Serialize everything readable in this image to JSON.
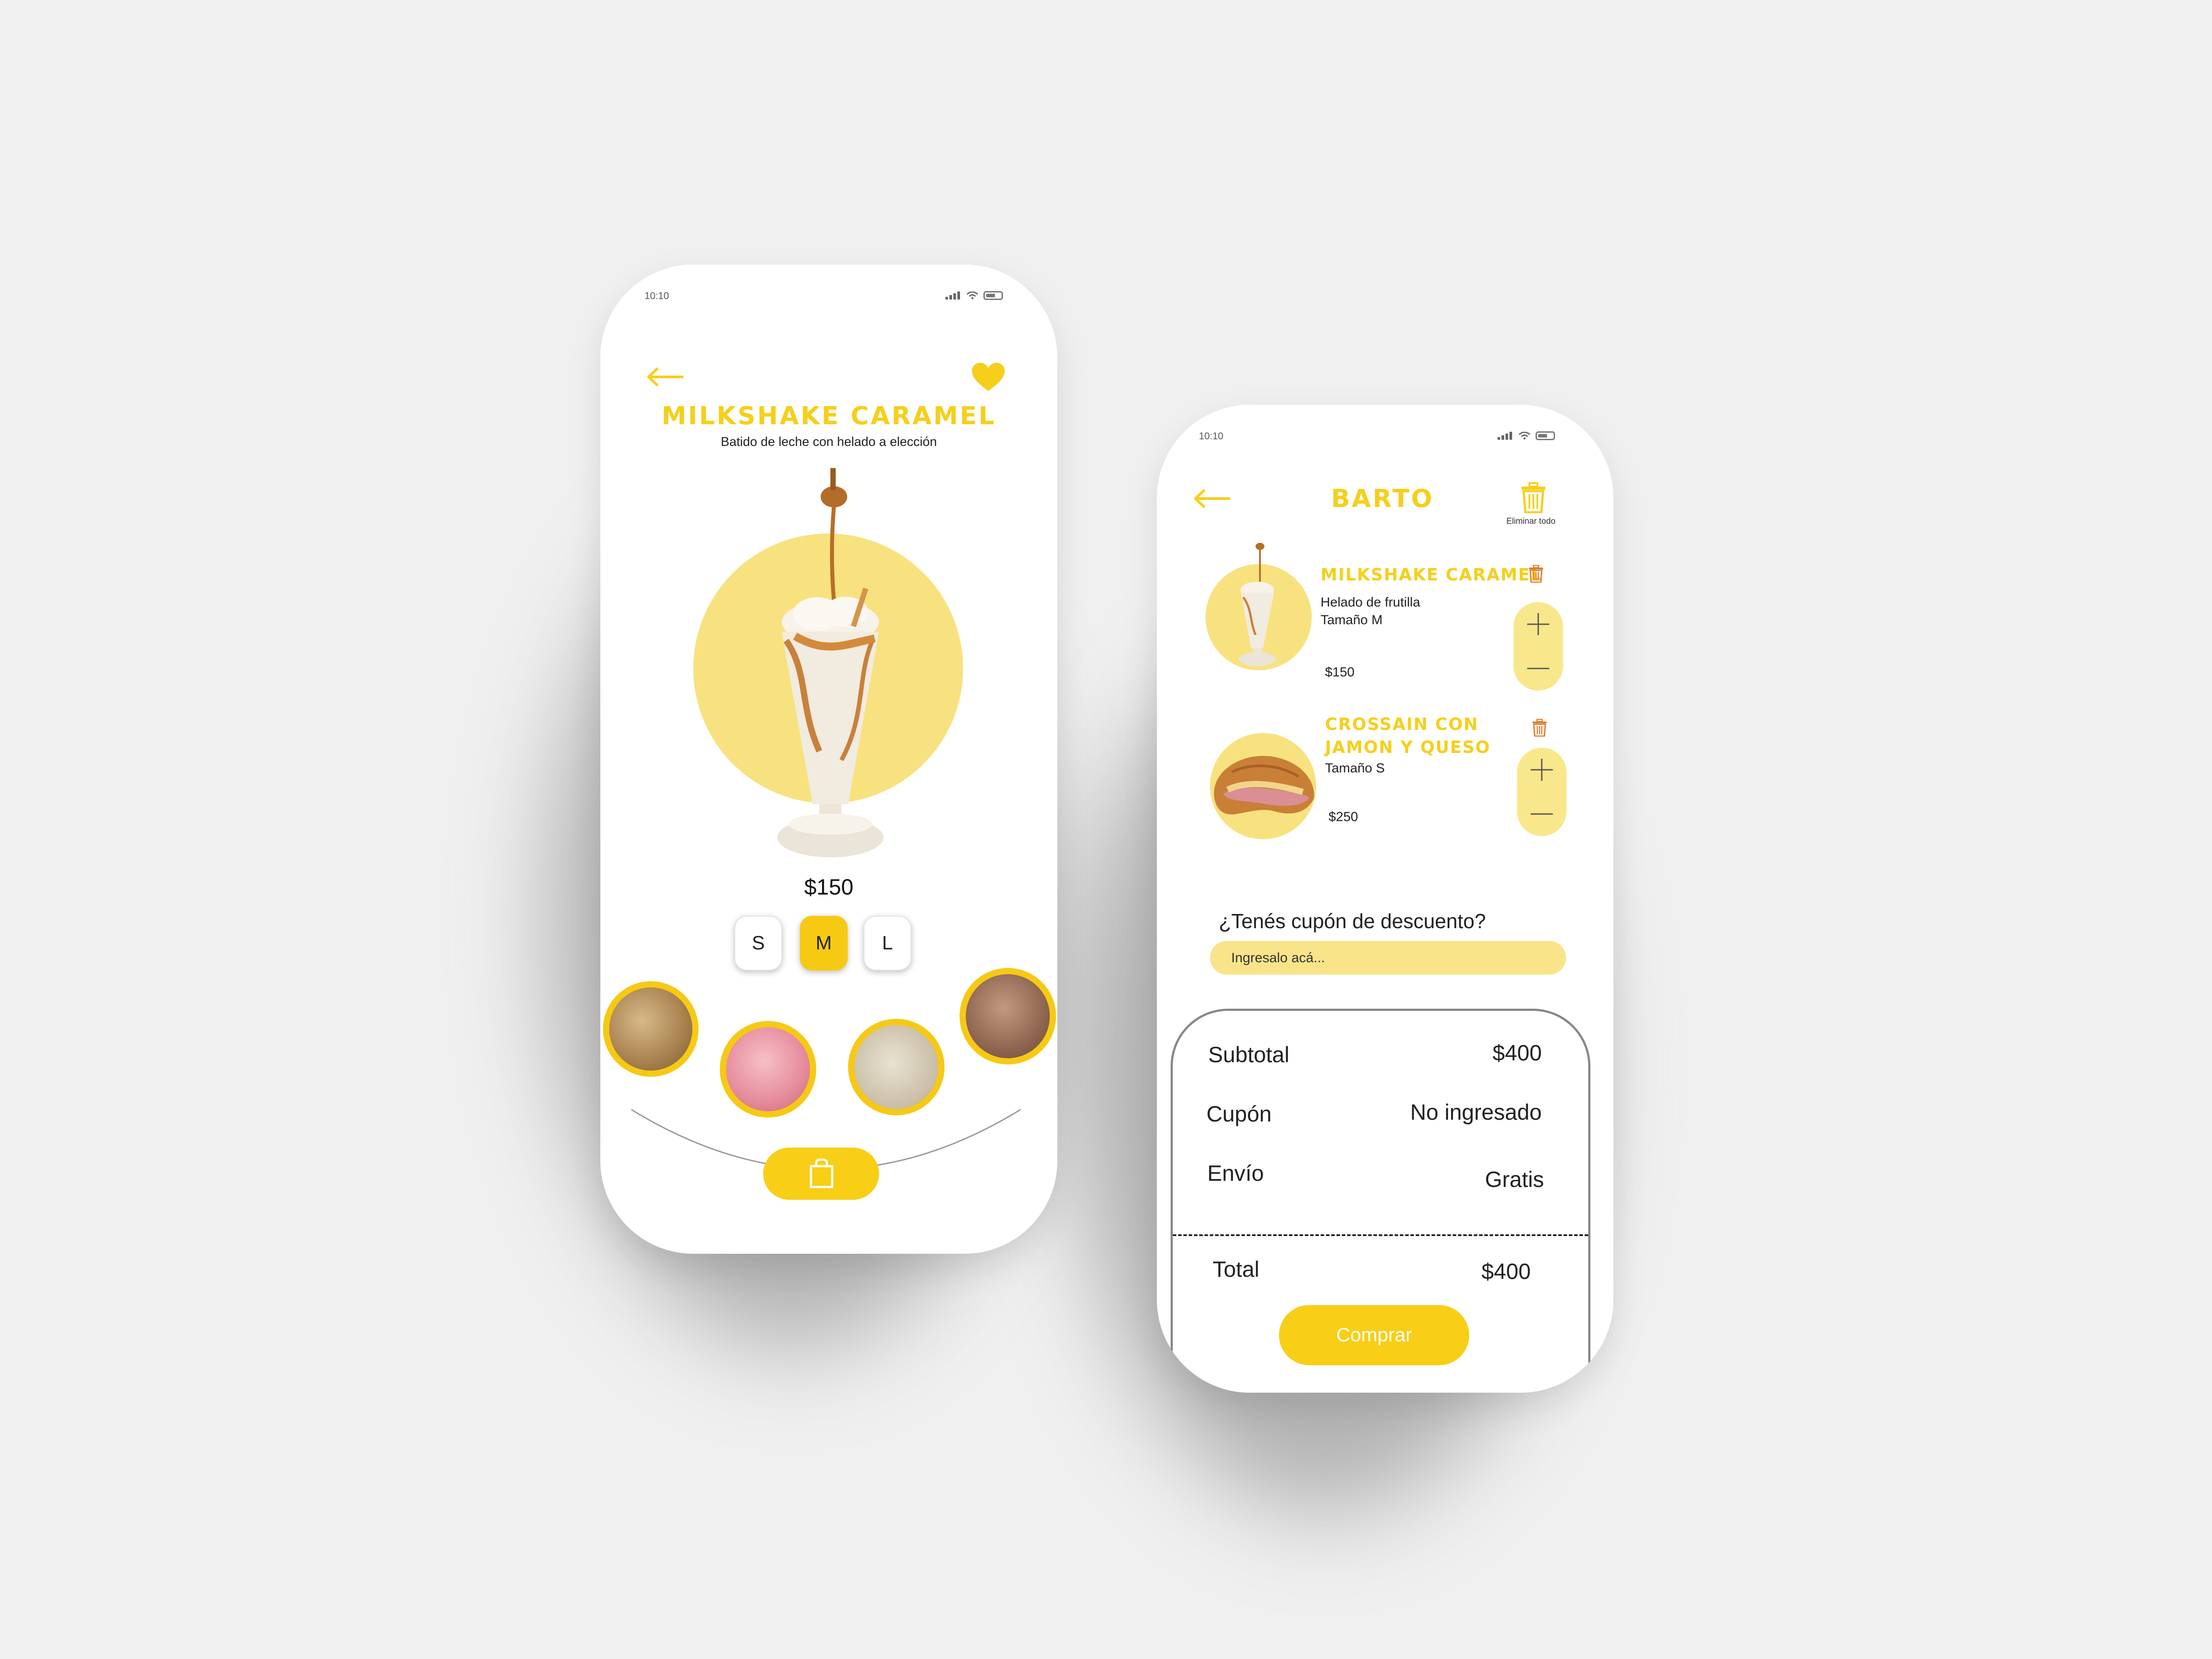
{
  "colors": {
    "accent": "#f6cf1c",
    "accent_light": "#f9e78c",
    "trash": "#e07b2a",
    "background": "#f0f0f0"
  },
  "product_screen": {
    "status_time": "10:10",
    "title": "MILKSHAKE CARAMEL",
    "subtitle": "Batido de leche con helado a elección",
    "price": "$150",
    "sizes": [
      "S",
      "M",
      "L"
    ],
    "selected_size": "M",
    "flavor_count": 4,
    "icons": [
      "back-arrow-icon",
      "heart-icon",
      "shopping-bag-icon"
    ]
  },
  "cart_screen": {
    "status_time": "10:10",
    "title": "BARTO",
    "delete_all_label": "Eliminar todo",
    "items": [
      {
        "name": "MILKSHAKE CARAMEL",
        "detail1": "Helado de frutilla",
        "detail2": "Tamaño M",
        "price": "$150"
      },
      {
        "name_line1": "CROSSAIN CON",
        "name_line2": "JAMON Y QUESO",
        "detail1": "Tamaño S",
        "price": "$250"
      }
    ],
    "coupon_question": "¿Tenés cupón de descuento?",
    "coupon_placeholder": "Ingresalo acá...",
    "summary": {
      "subtotal_label": "Subtotal",
      "subtotal_value": "$400",
      "coupon_label": "Cupón",
      "coupon_value": "No ingresado",
      "shipping_label": "Envío",
      "shipping_value": "Gratis",
      "total_label": "Total",
      "total_value": "$400"
    },
    "buy_label": "Comprar"
  }
}
